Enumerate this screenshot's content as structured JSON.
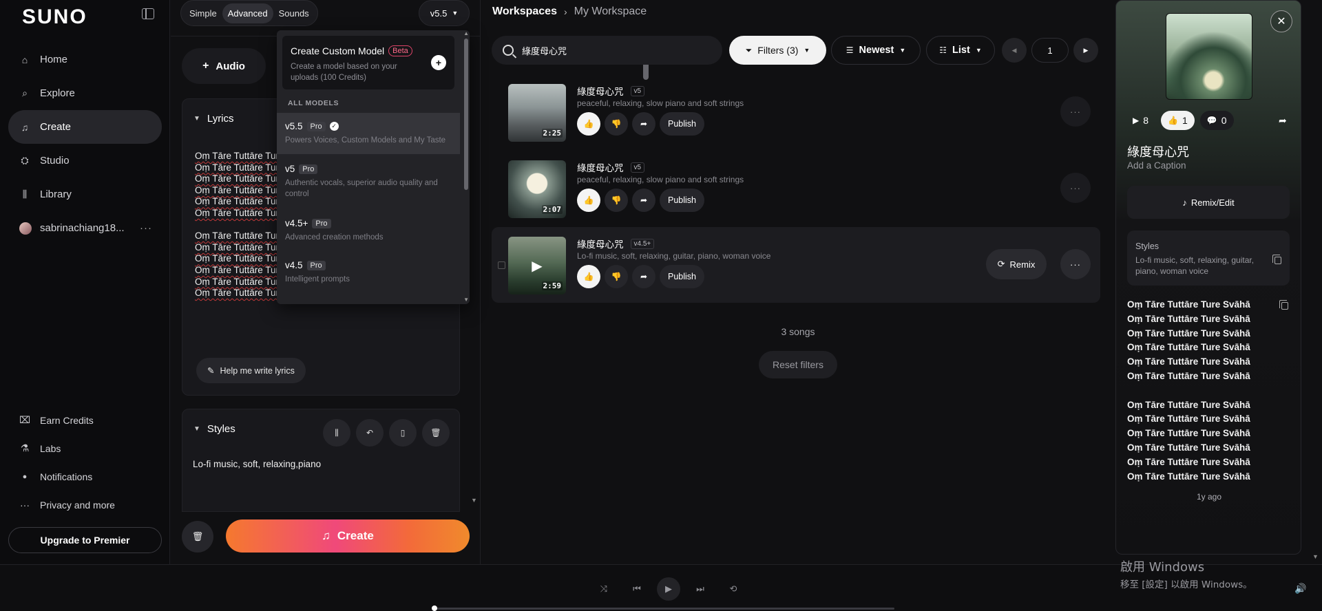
{
  "app": {
    "logo": "SUNO"
  },
  "sidebar": {
    "items": [
      {
        "label": "Home",
        "icon": "home-icon",
        "glyph": "⌂"
      },
      {
        "label": "Explore",
        "icon": "search-icon",
        "glyph": "⌕"
      },
      {
        "label": "Create",
        "icon": "music-note-icon",
        "glyph": "♫",
        "active": true
      },
      {
        "label": "Studio",
        "icon": "studio-icon",
        "glyph": "⛭"
      },
      {
        "label": "Library",
        "icon": "library-icon",
        "glyph": "⫼"
      }
    ],
    "user": {
      "name": "sabrinachiang18...",
      "more": "···"
    },
    "bottom": [
      {
        "label": "Earn Credits",
        "icon": "gift-icon",
        "glyph": "⌧"
      },
      {
        "label": "Labs",
        "icon": "flask-icon",
        "glyph": "⚗"
      },
      {
        "label": "Notifications",
        "icon": "bell-icon",
        "glyph": "🔔"
      },
      {
        "label": "Privacy and more",
        "icon": "more-icon",
        "glyph": "···"
      }
    ],
    "upgrade_label": "Upgrade to Premier"
  },
  "create": {
    "tabs": [
      "Simple",
      "Advanced",
      "Sounds"
    ],
    "active_tab": "Advanced",
    "version": "v5.5",
    "audio_label": "Audio",
    "lyrics_title": "Lyrics",
    "lyrics_lines": [
      "Oṃ Tāre Tuttāre Ture",
      "Oṃ Tāre Tuttāre Ture",
      "Oṃ Tāre Tuttāre Ture",
      "Oṃ Tāre Tuttāre Ture",
      "Oṃ Tāre Tuttāre Ture",
      "Oṃ Tāre Tuttāre Ture",
      "",
      "Oṃ Tāre Tuttāre Ture",
      "Oṃ Tāre Tuttāre Ture",
      "Oṃ Tāre Tuttāre Ture",
      "Oṃ Tāre Tuttāre Ture",
      "Oṃ Tāre Tuttāre Ture Svāhā",
      "Oṃ Tāre Tuttāre Ture Svāhā"
    ],
    "help_label": "Help me write lyrics",
    "styles_title": "Styles",
    "styles_value": "Lo-fi music, soft, relaxing,piano",
    "create_label": "Create"
  },
  "model_dropdown": {
    "custom": {
      "title": "Create Custom Model",
      "badge": "Beta",
      "desc": "Create a model based on your uploads (100 Credits)"
    },
    "section_label": "ALL MODELS",
    "models": [
      {
        "name": "v5.5",
        "badge": "Pro",
        "desc": "Powers Voices, Custom Models and My Taste",
        "selected": true
      },
      {
        "name": "v5",
        "badge": "Pro",
        "desc": "Authentic vocals, superior audio quality and control"
      },
      {
        "name": "v4.5+",
        "badge": "Pro",
        "desc": "Advanced creation methods"
      },
      {
        "name": "v4.5",
        "badge": "Pro",
        "desc": "Intelligent prompts"
      }
    ]
  },
  "workspace": {
    "breadcrumb_root": "Workspaces",
    "breadcrumb_current": "My Workspace",
    "search_value": "綠度母心咒",
    "filters_label": "Filters (3)",
    "sort_label": "Newest",
    "view_label": "List",
    "page": "1",
    "songs": [
      {
        "title": "綠度母心咒",
        "version": "v5",
        "tags": "peaceful, relaxing, slow piano and soft strings",
        "duration": "2:25"
      },
      {
        "title": "綠度母心咒",
        "version": "v5",
        "tags": "peaceful, relaxing, slow piano and soft strings",
        "duration": "2:07"
      },
      {
        "title": "綠度母心咒",
        "version": "v4.5+",
        "tags": "Lo-fi music, soft, relaxing, guitar, piano, woman voice",
        "duration": "2:59"
      }
    ],
    "publish_label": "Publish",
    "remix_label": "Remix",
    "songs_count": "3 songs",
    "reset_label": "Reset filters"
  },
  "detail": {
    "plays": "8",
    "likes": "1",
    "comments": "0",
    "title": "綠度母心咒",
    "caption_placeholder": "Add a Caption",
    "remix_edit_label": "Remix/Edit",
    "styles_label": "Styles",
    "styles_value": "Lo-fi music, soft, relaxing, guitar, piano, woman voice",
    "lyrics_lines": [
      "Oṃ Tāre Tuttāre Ture Svāhā",
      "Oṃ Tāre Tuttāre Ture Svāhā",
      "Oṃ Tāre Tuttāre Ture Svāhā",
      "Oṃ Tāre Tuttāre Ture Svāhā",
      "Oṃ Tāre Tuttāre Ture Svāhā",
      "Oṃ Tāre Tuttāre Ture Svāhā",
      "",
      "Oṃ Tāre Tuttāre Ture Svāhā",
      "Oṃ Tāre Tuttāre Ture Svāhā",
      "Oṃ Tāre Tuttāre Ture Svāhā",
      "Oṃ Tāre Tuttāre Ture Svāhā",
      "Oṃ Tāre Tuttāre Ture Svāhā",
      "Oṃ Tāre Tuttāre Ture Svāhā"
    ],
    "time_ago": "1y ago"
  },
  "player": {
    "progress": 0
  },
  "watermark": {
    "line1": "啟用 Windows",
    "line2": "移至 [設定] 以啟用 Windows。"
  },
  "colors": {
    "accent_gradient_start": "#f5792e",
    "accent_gradient_mid": "#f0497a",
    "background": "#101012"
  }
}
